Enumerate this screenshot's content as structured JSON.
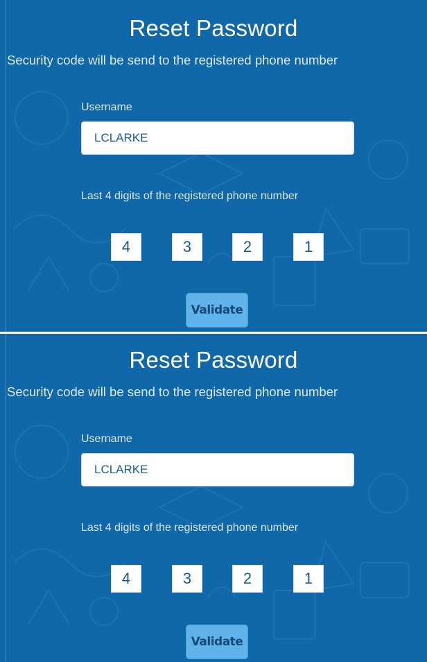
{
  "screens": [
    {
      "title": "Reset Password",
      "subtitle": "Security code will be send to the registered phone number",
      "username_label": "Username",
      "username_value": "LCLARKE",
      "digits_label": "Last 4 digits of the registered phone number",
      "digits": [
        "4",
        "3",
        "2",
        "1"
      ],
      "validate_label": "Validate"
    },
    {
      "title": "Reset Password",
      "subtitle": "Security code will be send to the registered phone number",
      "username_label": "Username",
      "username_value": "LCLARKE",
      "digits_label": "Last 4 digits of the registered phone number",
      "digits": [
        "4",
        "3",
        "2",
        "1"
      ],
      "validate_label": "Validate"
    }
  ],
  "colors": {
    "background": "#1168a8",
    "button": "#5fb3ea",
    "input_text": "#1a5a93"
  }
}
